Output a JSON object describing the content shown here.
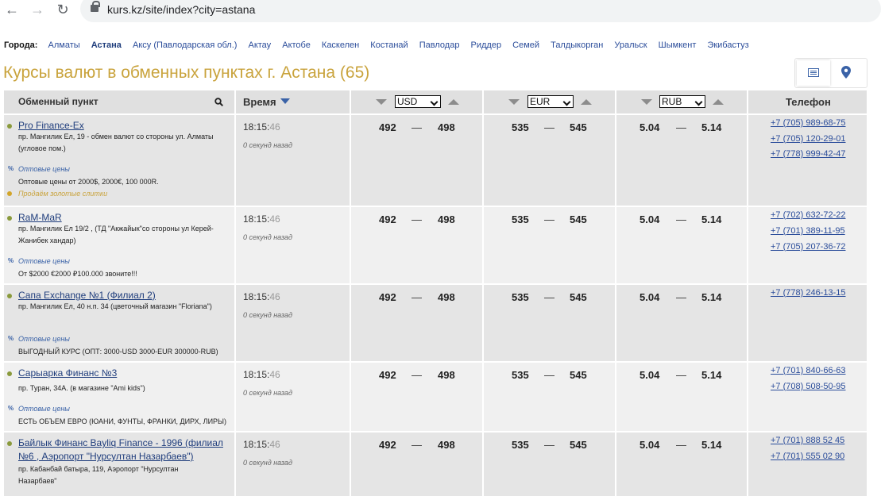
{
  "browser": {
    "url": "kurs.kz/site/index?city=astana"
  },
  "cities": {
    "label": "Города:",
    "items": [
      "Алматы",
      "Астана",
      "Аксу (Павлодарская обл.)",
      "Актау",
      "Актобе",
      "Каскелен",
      "Костанай",
      "Павлодар",
      "Риддер",
      "Семей",
      "Талдыкорган",
      "Уральск",
      "Шымкент",
      "Экибастуз"
    ],
    "active": "Астана"
  },
  "page": {
    "title": "Курсы валют в обменных пунктах г. Астана (65)"
  },
  "table": {
    "headers": {
      "exchange": "Обменный пункт",
      "time": "Время",
      "usd": "USD",
      "eur": "EUR",
      "rub": "RUB",
      "phone": "Телефон"
    },
    "rows": [
      {
        "name": "Pro Finance-Ex",
        "address": "пр. Мангилик Ел, 19 - обмен валют со стороны ул. Алматы (угловое пом.)",
        "wholesale_label": "Оптовые цены",
        "wholesale_text": "Оптовые цены от 2000$, 2000€, 100 000R.",
        "gold_text": "Продаём золотые слитки",
        "time_hm": "18:15:",
        "time_s": "46",
        "ago": "0 секунд назад",
        "usd_buy": "492",
        "usd_sell": "498",
        "eur_buy": "535",
        "eur_sell": "545",
        "rub_buy": "5.04",
        "rub_sell": "5.14",
        "phones": [
          "+7 (705) 989-68-75",
          "+7 (705) 120-29-01",
          "+7 (778) 999-42-47"
        ]
      },
      {
        "name": "RaM-MaR",
        "address": "пр. Мангилик Ел 19/2 , (ТД \"Акжайык\"со стороны ул Керей-Жанибек хандар)",
        "wholesale_label": "Оптовые цены",
        "wholesale_text": "От $2000 €2000 ₽100.000 звоните!!!",
        "time_hm": "18:15:",
        "time_s": "46",
        "ago": "0 секунд назад",
        "usd_buy": "492",
        "usd_sell": "498",
        "eur_buy": "535",
        "eur_sell": "545",
        "rub_buy": "5.04",
        "rub_sell": "5.14",
        "phones": [
          "+7 (702) 632-72-22",
          "+7 (701) 389-11-95",
          "+7 (705) 207-36-72"
        ]
      },
      {
        "name": "Сапа Exchange №1 (Филиал 2)",
        "address": "пр. Мангилик Ел, 40 н.п. 34 (цветочный магазин \"Floriana\")",
        "wholesale_label": "Оптовые цены",
        "wholesale_text": "ВЫГОДНЫЙ КУРС (ОПТ: 3000-USD 3000-EUR 300000-RUB)",
        "time_hm": "18:15:",
        "time_s": "46",
        "ago": "0 секунд назад",
        "usd_buy": "492",
        "usd_sell": "498",
        "eur_buy": "535",
        "eur_sell": "545",
        "rub_buy": "5.04",
        "rub_sell": "5.14",
        "phones": [
          "+7 (778) 246-13-15"
        ]
      },
      {
        "name": "Сарыарка Финанс №3",
        "address": "пр. Туран, 34А. (в магазине \"Ami kids\")",
        "wholesale_label": "Оптовые цены",
        "wholesale_text": "ЕСТЬ ОБЪЕМ ЕВРО (ЮАНИ, ФУНТЫ, ФРАНКИ, ДИРХ, ЛИРЫ)",
        "time_hm": "18:15:",
        "time_s": "46",
        "ago": "0 секунд назад",
        "usd_buy": "492",
        "usd_sell": "498",
        "eur_buy": "535",
        "eur_sell": "545",
        "rub_buy": "5.04",
        "rub_sell": "5.14",
        "phones": [
          "+7 (701) 840-66-63",
          "+7 (708) 508-50-95"
        ]
      },
      {
        "name": "Байлык Финанс Bayliq Finance - 1996 (филиал №6 , Аэропорт \"Нурсултан Назарбаев\")",
        "address": "пр. Кабанбай батыра, 119, Аэропорт \"Нурсултан Назарбаев\"",
        "time_hm": "18:15:",
        "time_s": "46",
        "ago": "0 секунд назад",
        "usd_buy": "492",
        "usd_sell": "498",
        "eur_buy": "535",
        "eur_sell": "545",
        "rub_buy": "5.04",
        "rub_sell": "5.14",
        "phones": [
          "+7 (701) 888 52 45",
          "+7 (701) 555 02 90"
        ]
      }
    ]
  },
  "colors": {
    "title": "#c9a33c",
    "link": "#2a4c9a",
    "row_bg": "#f0f0f0",
    "row_alt_bg": "#e5e5e5"
  }
}
